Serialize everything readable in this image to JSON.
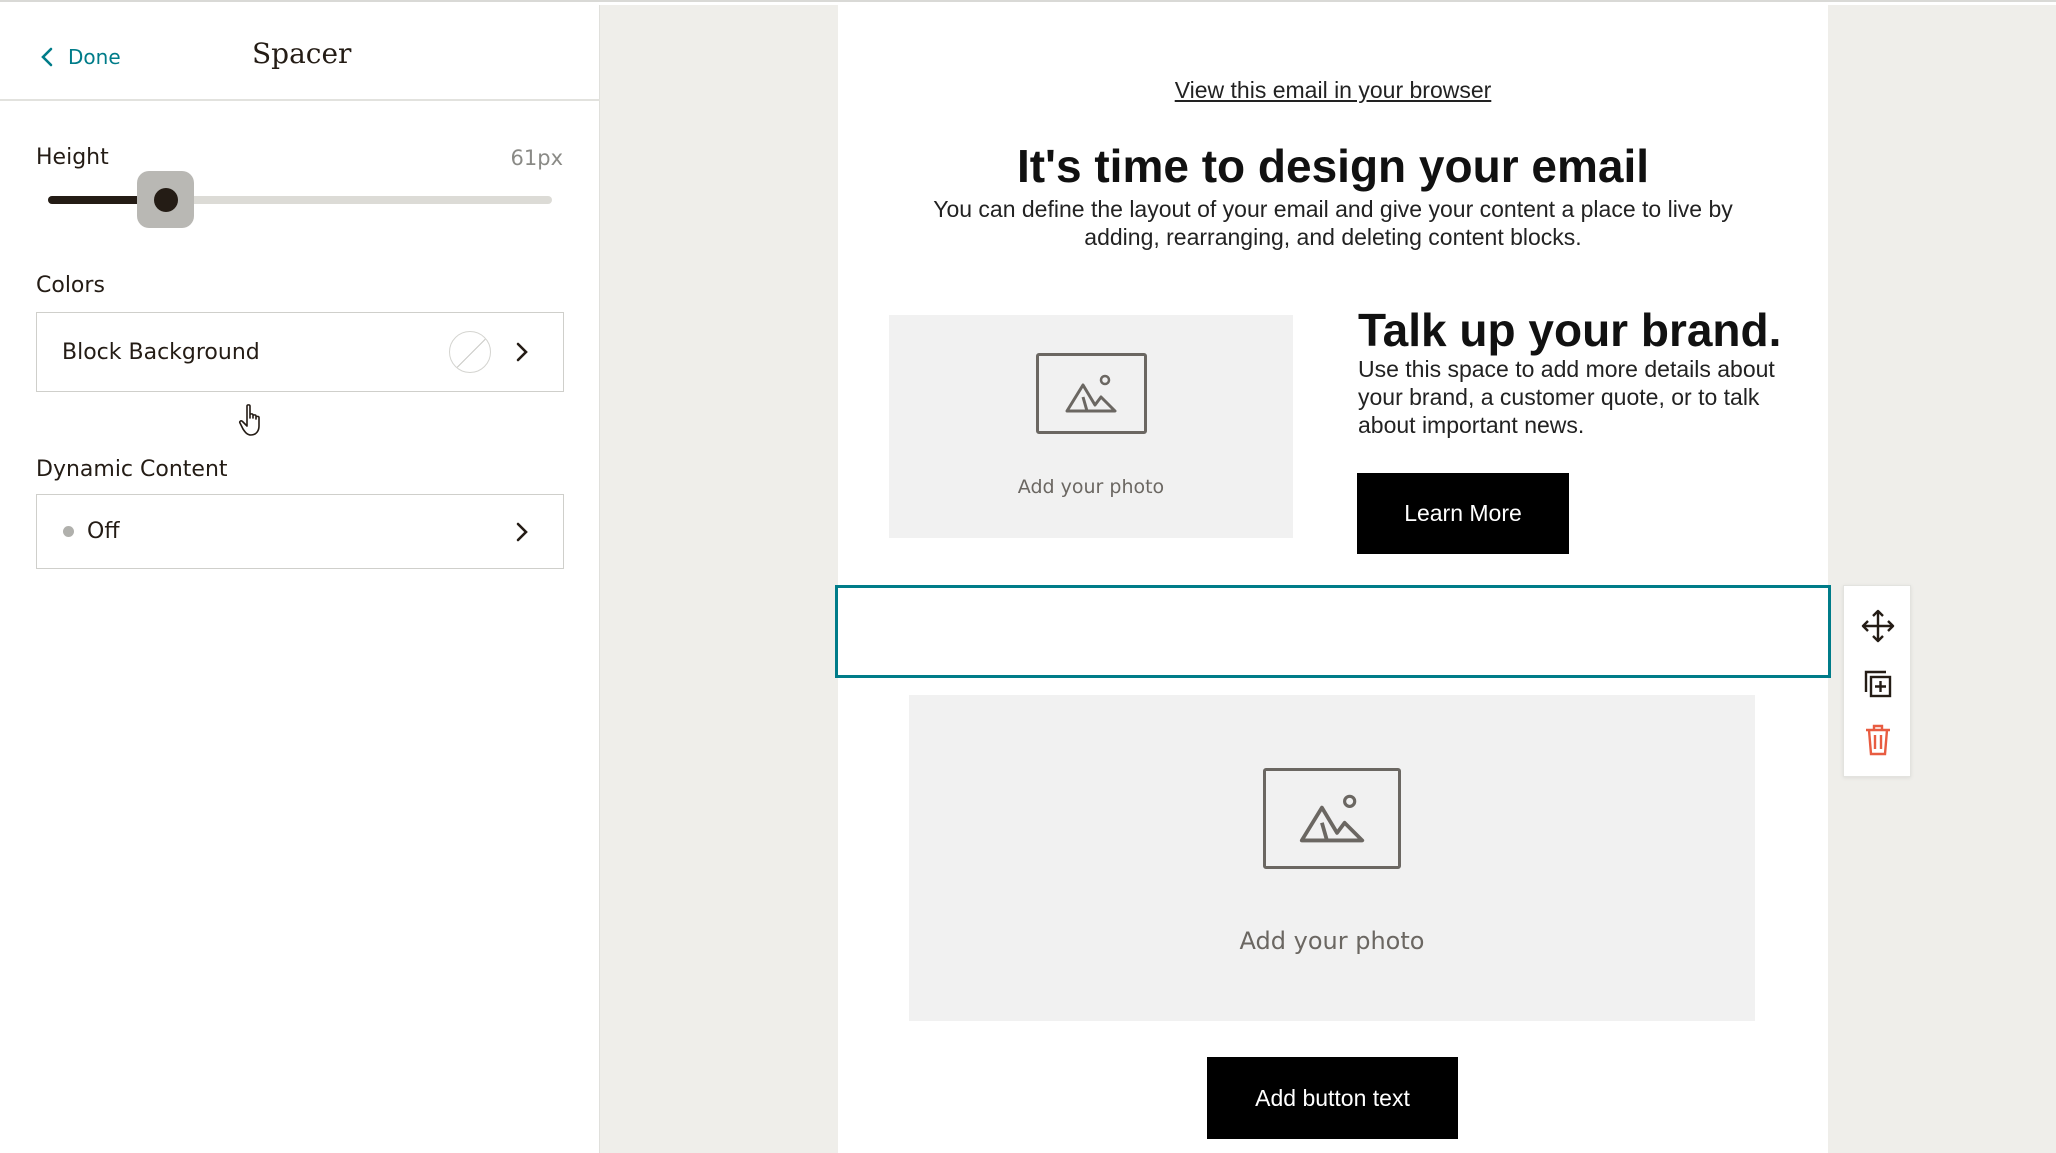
{
  "panel": {
    "done_label": "Done",
    "title": "Spacer",
    "height_label": "Height",
    "height_value": "61px",
    "height_slider_level": 0.23,
    "colors_label": "Colors",
    "block_background_label": "Block Background",
    "dynamic_label": "Dynamic Content",
    "dynamic_value": "Off"
  },
  "email": {
    "browser_link": "View this email in your browser",
    "headline": "It's time to design your email",
    "subtext": "You can define the layout of your email and give your content a place to live by adding, rearranging, and deleting content blocks.",
    "photo1_label": "Add your photo",
    "brand_title": "Talk up your brand.",
    "brand_text": "Use this space to add more details about your brand, a customer quote, or to talk about important news.",
    "learn_more": "Learn More",
    "photo2_label": "Add your photo",
    "button_text": "Add button text"
  },
  "toolbar": {
    "icons": [
      "move-icon",
      "duplicate-icon",
      "delete-icon"
    ]
  },
  "colors": {
    "accent": "#007c89",
    "text": "#241c15",
    "delete": "#e85c41",
    "canvas_bg": "#efeeea"
  }
}
